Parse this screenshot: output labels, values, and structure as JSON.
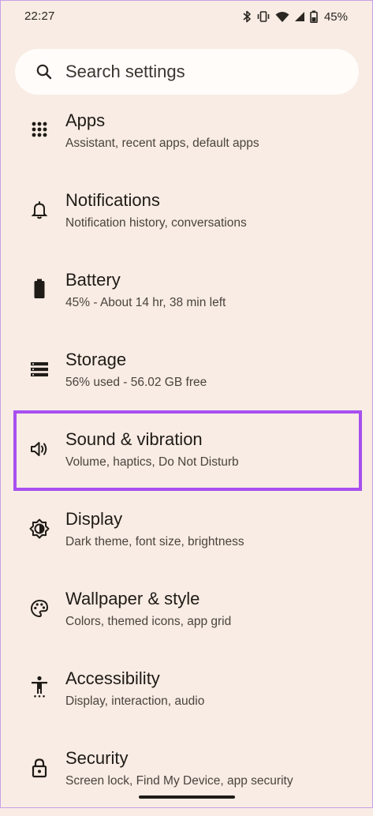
{
  "status_bar": {
    "time": "22:27",
    "battery_percent": "45%",
    "icons": [
      "bluetooth-icon",
      "vibrate-icon",
      "wifi-icon",
      "cellular-signal-icon",
      "battery-icon"
    ]
  },
  "search": {
    "placeholder": "Search settings",
    "icon": "search-icon"
  },
  "settings": [
    {
      "id": "apps",
      "icon": "apps-grid-icon",
      "title": "Apps",
      "subtitle": "Assistant, recent apps, default apps"
    },
    {
      "id": "notifications",
      "icon": "bell-icon",
      "title": "Notifications",
      "subtitle": "Notification history, conversations"
    },
    {
      "id": "battery",
      "icon": "battery-icon",
      "title": "Battery",
      "subtitle": "45% - About 14 hr, 38 min left"
    },
    {
      "id": "storage",
      "icon": "storage-icon",
      "title": "Storage",
      "subtitle": "56% used - 56.02 GB free"
    },
    {
      "id": "sound",
      "icon": "speaker-icon",
      "title": "Sound & vibration",
      "subtitle": "Volume, haptics, Do Not Disturb",
      "highlighted": true
    },
    {
      "id": "display",
      "icon": "brightness-icon",
      "title": "Display",
      "subtitle": "Dark theme, font size, brightness"
    },
    {
      "id": "wallpaper",
      "icon": "palette-icon",
      "title": "Wallpaper & style",
      "subtitle": "Colors, themed icons, app grid"
    },
    {
      "id": "accessibility",
      "icon": "accessibility-icon",
      "title": "Accessibility",
      "subtitle": "Display, interaction, audio"
    },
    {
      "id": "security",
      "icon": "lock-icon",
      "title": "Security",
      "subtitle": "Screen lock, Find My Device, app security"
    }
  ],
  "colors": {
    "background": "#f8ece4",
    "search_background": "#fffcfa",
    "highlight": "#a84ff0",
    "text_primary": "#1f1b16",
    "text_secondary": "#4a443d"
  }
}
